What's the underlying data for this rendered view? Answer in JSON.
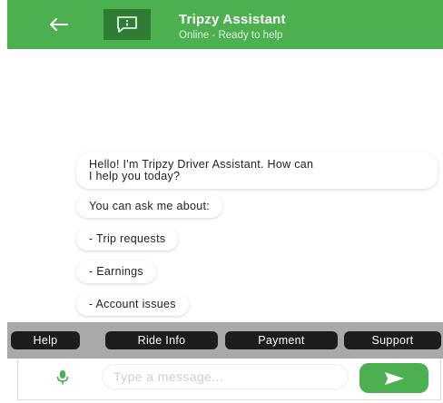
{
  "colors": {
    "accent": "#4caf50",
    "accent_dark": "#2e7d32",
    "chip_bg": "#1d1d1d",
    "quick_bar_bg": "#a9a9a9"
  },
  "header": {
    "back_icon": "arrow-left-icon",
    "avatar_icon": "chat-bubble-icon",
    "title": "Tripzy Assistant",
    "subtitle": "Online - Ready to help"
  },
  "messages": [
    {
      "sender": "bot",
      "lines": [
        "Hello! I'm Tripzy Driver Assistant. How can",
        "I help you today?"
      ]
    },
    {
      "sender": "bot",
      "lines": [
        "You can ask me about:"
      ]
    },
    {
      "sender": "bot",
      "lines": [
        "- Trip requests"
      ]
    },
    {
      "sender": "bot",
      "lines": [
        "- Earnings"
      ]
    },
    {
      "sender": "bot",
      "lines": [
        "- Account issues"
      ]
    }
  ],
  "quick_replies": [
    "Help",
    "Ride Info",
    "Payment",
    "Support"
  ],
  "composer": {
    "mic_icon": "microphone-icon",
    "placeholder": "Type a message...",
    "value": "",
    "send_icon": "send-icon"
  }
}
